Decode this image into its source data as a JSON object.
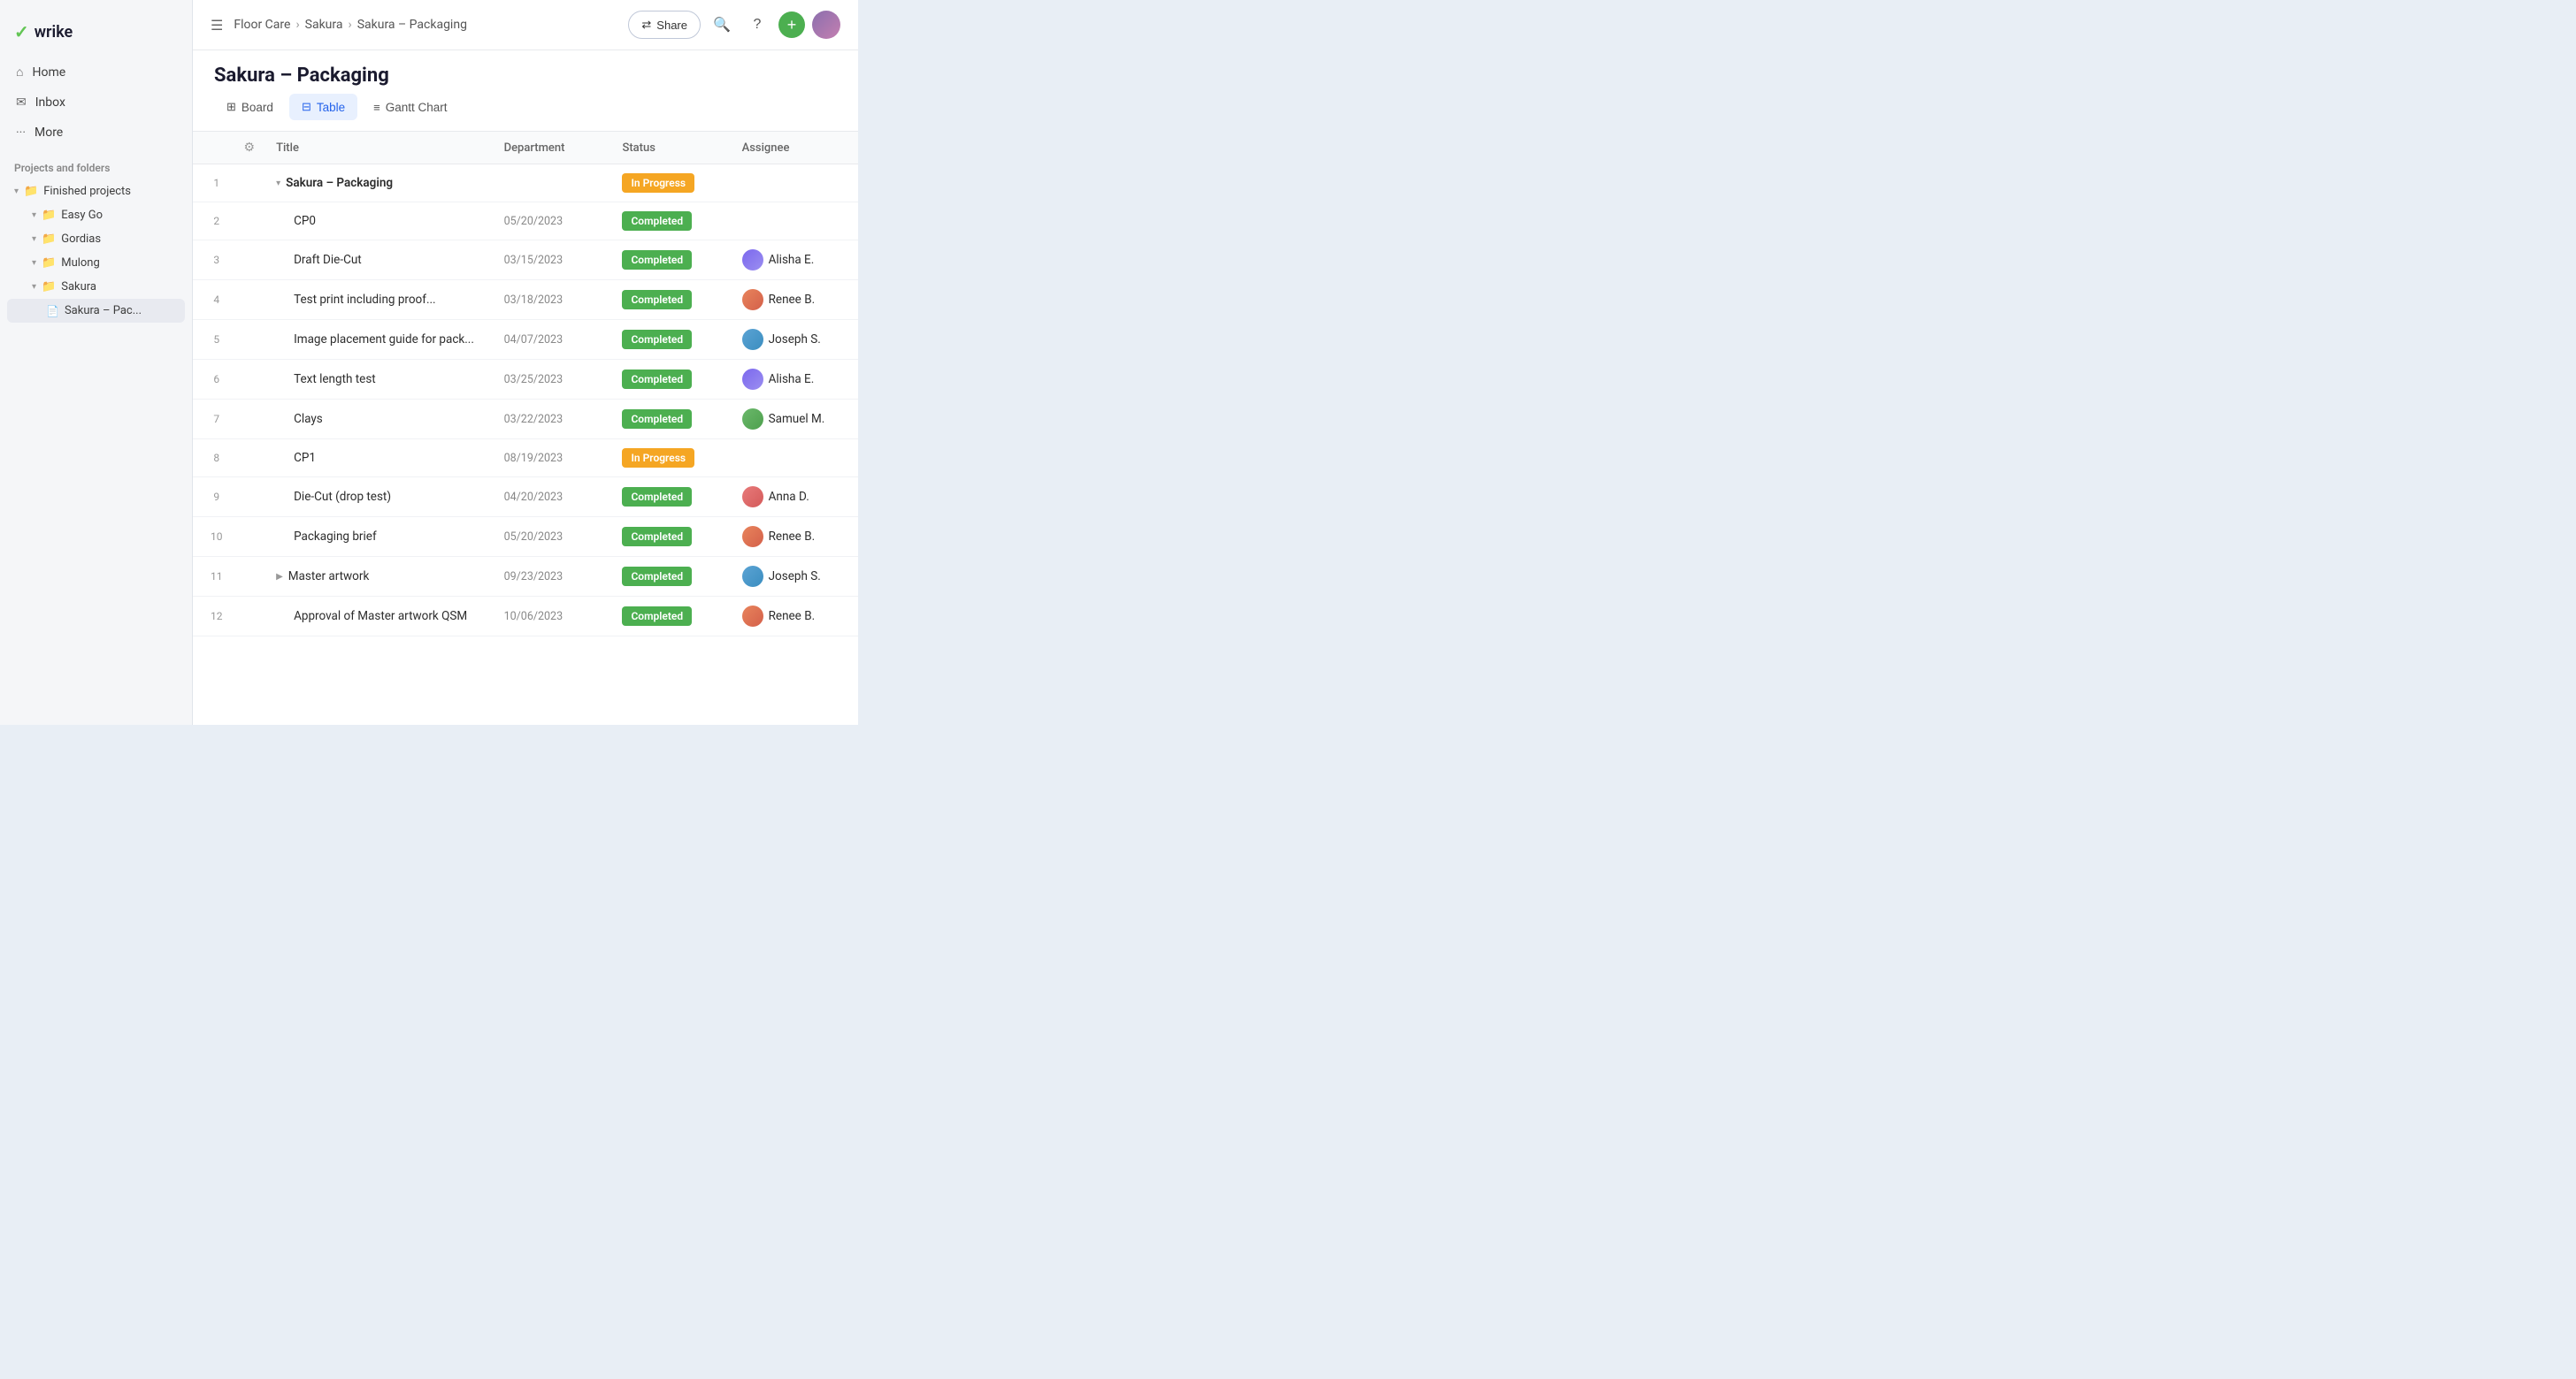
{
  "logo": {
    "check": "✓",
    "name": "wrike"
  },
  "sidebar": {
    "nav_items": [
      {
        "id": "home",
        "icon": "⌂",
        "label": "Home"
      },
      {
        "id": "inbox",
        "icon": "✉",
        "label": "Inbox"
      },
      {
        "id": "more",
        "icon": "···",
        "label": "More"
      }
    ],
    "section_label": "Projects and folders",
    "tree": [
      {
        "id": "finished",
        "indent": 0,
        "icon": "📁",
        "label": "Finished projects",
        "expanded": true
      },
      {
        "id": "easygo",
        "indent": 1,
        "icon": "📁",
        "label": "Easy Go"
      },
      {
        "id": "gordias",
        "indent": 1,
        "icon": "📁",
        "label": "Gordias"
      },
      {
        "id": "mulong",
        "indent": 1,
        "icon": "📁",
        "label": "Mulong"
      },
      {
        "id": "sakura",
        "indent": 1,
        "icon": "📁",
        "label": "Sakura",
        "expanded": true
      },
      {
        "id": "sakura-pac",
        "indent": 2,
        "icon": "📄",
        "label": "Sakura – Pac...",
        "active": true
      }
    ]
  },
  "header": {
    "breadcrumb": [
      "Floor Care",
      "Sakura",
      "Sakura – Packaging"
    ],
    "share_label": "Share",
    "search_label": "Search",
    "help_label": "Help",
    "add_label": "+"
  },
  "page": {
    "title": "Sakura – Packaging"
  },
  "tabs": [
    {
      "id": "board",
      "icon": "⊞",
      "label": "Board"
    },
    {
      "id": "table",
      "icon": "⊟",
      "label": "Table",
      "active": true
    },
    {
      "id": "gantt",
      "icon": "≡",
      "label": "Gantt Chart"
    }
  ],
  "table": {
    "columns": [
      {
        "id": "num",
        "label": ""
      },
      {
        "id": "settings",
        "label": "⚙"
      },
      {
        "id": "title",
        "label": "Title"
      },
      {
        "id": "dept",
        "label": "Department"
      },
      {
        "id": "status",
        "label": "Status"
      },
      {
        "id": "assignee",
        "label": "Assignee"
      }
    ],
    "rows": [
      {
        "num": "1",
        "expand": "▾",
        "title": "Sakura – Packaging",
        "title_bold": true,
        "dept": "",
        "status": "In Progress",
        "status_type": "inprogress",
        "assignee_name": "",
        "assignee_class": ""
      },
      {
        "num": "2",
        "expand": "",
        "title": "CP0",
        "title_bold": false,
        "dept": "05/20/2023",
        "status": "Completed",
        "status_type": "completed",
        "assignee_name": "",
        "assignee_class": ""
      },
      {
        "num": "3",
        "expand": "",
        "title": "Draft Die-Cut",
        "title_bold": false,
        "dept": "03/15/2023",
        "status": "Completed",
        "status_type": "completed",
        "assignee_name": "Alisha E.",
        "assignee_class": "av-alisha"
      },
      {
        "num": "4",
        "expand": "",
        "title": "Test print including proof...",
        "title_bold": false,
        "dept": "03/18/2023",
        "status": "Completed",
        "status_type": "completed",
        "assignee_name": "Renee B.",
        "assignee_class": "av-renee"
      },
      {
        "num": "5",
        "expand": "",
        "title": "Image placement guide for pack...",
        "title_bold": false,
        "dept": "04/07/2023",
        "status": "Completed",
        "status_type": "completed",
        "assignee_name": "Joseph S.",
        "assignee_class": "av-joseph"
      },
      {
        "num": "6",
        "expand": "",
        "title": "Text length test",
        "title_bold": false,
        "dept": "03/25/2023",
        "status": "Completed",
        "status_type": "completed",
        "assignee_name": "Alisha E.",
        "assignee_class": "av-alisha"
      },
      {
        "num": "7",
        "expand": "",
        "title": "Clays",
        "title_bold": false,
        "dept": "03/22/2023",
        "status": "Completed",
        "status_type": "completed",
        "assignee_name": "Samuel M.",
        "assignee_class": "av-samuel"
      },
      {
        "num": "8",
        "expand": "",
        "title": "CP1",
        "title_bold": false,
        "dept": "08/19/2023",
        "status": "In Progress",
        "status_type": "inprogress",
        "assignee_name": "",
        "assignee_class": ""
      },
      {
        "num": "9",
        "expand": "",
        "title": "Die-Cut (drop test)",
        "title_bold": false,
        "dept": "04/20/2023",
        "status": "Completed",
        "status_type": "completed",
        "assignee_name": "Anna D.",
        "assignee_class": "av-anna"
      },
      {
        "num": "10",
        "expand": "",
        "title": "Packaging brief",
        "title_bold": false,
        "dept": "05/20/2023",
        "status": "Completed",
        "status_type": "completed",
        "assignee_name": "Renee B.",
        "assignee_class": "av-renee"
      },
      {
        "num": "11",
        "expand": "▶",
        "title": "Master artwork",
        "title_bold": false,
        "dept": "09/23/2023",
        "status": "Completed",
        "status_type": "completed",
        "assignee_name": "Joseph S.",
        "assignee_class": "av-joseph"
      },
      {
        "num": "12",
        "expand": "",
        "title": "Approval of Master artwork QSM",
        "title_bold": false,
        "dept": "10/06/2023",
        "status": "Completed",
        "status_type": "completed",
        "assignee_name": "Renee B.",
        "assignee_class": "av-renee"
      }
    ]
  }
}
